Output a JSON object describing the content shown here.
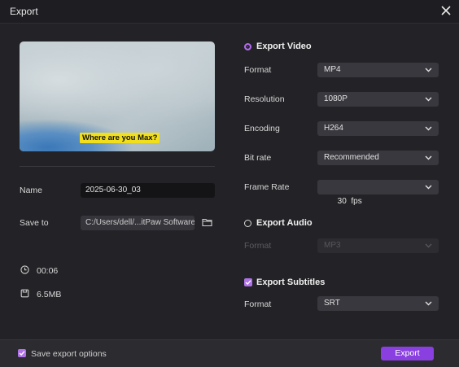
{
  "window": {
    "title": "Export"
  },
  "preview": {
    "subtitle_text": "Where are you Max?"
  },
  "left": {
    "name_label": "Name",
    "name_value": "2025-06-30_03",
    "save_label": "Save to",
    "save_path": "C:/Users/dell/...itPaw Software",
    "duration": "00:06",
    "size": "6.5MB"
  },
  "video": {
    "heading": "Export Video",
    "enabled": true,
    "rows": [
      {
        "label": "Format",
        "value": "MP4"
      },
      {
        "label": "Resolution",
        "value": "1080P"
      },
      {
        "label": "Encoding",
        "value": "H264"
      },
      {
        "label": "Bit rate",
        "value": "Recommended"
      },
      {
        "label": "Frame Rate",
        "value": "30  fps"
      }
    ]
  },
  "audio": {
    "heading": "Export Audio",
    "enabled": false,
    "format_label": "Format",
    "format_value": "MP3"
  },
  "subtitles": {
    "heading": "Export Subtitles",
    "enabled": true,
    "format_label": "Format",
    "format_value": "SRT"
  },
  "footer": {
    "save_options_label": "Save export options",
    "save_options_checked": true,
    "export_button": "Export"
  },
  "colors": {
    "accent": "#8a3fe0",
    "check": "#b072e8",
    "subtitle_bg": "#f2df1b"
  }
}
